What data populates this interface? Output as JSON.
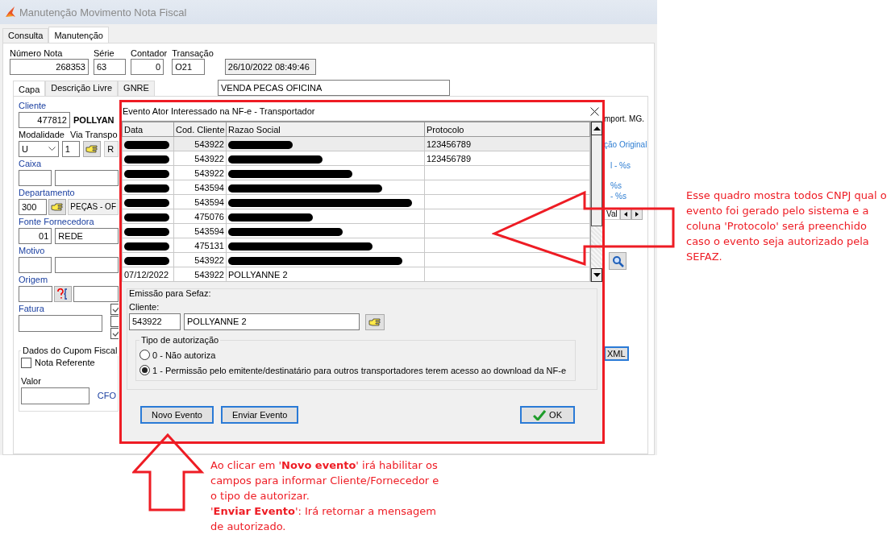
{
  "window": {
    "title": "Manutenção Movimento Nota Fiscal"
  },
  "tabs": [
    {
      "label": "Consulta",
      "selected": false
    },
    {
      "label": "Manutenção",
      "selected": true
    }
  ],
  "header_fields": [
    {
      "label": "Número Nota",
      "value": "268353",
      "kind": "numeric"
    },
    {
      "label": "Série",
      "value": "63",
      "kind": "text"
    },
    {
      "label": "Contador",
      "value": "0",
      "kind": "numeric"
    },
    {
      "label": "Transação",
      "value": "O21",
      "kind": "text"
    },
    {
      "value": "26/10/2022 08:49:46",
      "kind": "readonly"
    }
  ],
  "inner_tabs": [
    {
      "label": "Capa",
      "selected": true
    },
    {
      "label": "Descrição Livre",
      "selected": false
    },
    {
      "label": "GNRE",
      "selected": false
    }
  ],
  "description": "VENDA PECAS OFICINA",
  "capa": {
    "cliente_label": "Cliente",
    "cliente_code": "477812",
    "cliente_name": "POLLYAN",
    "modalidade_label": "Modalidade",
    "modalidade_value": "U",
    "via_label": "Via Transpo",
    "via_value": "1",
    "via_name": "R",
    "caixa_label": "Caixa",
    "departamento_label": "Departamento",
    "departamento_code": "300",
    "departamento_name": "PEÇAS - OF",
    "fonte_label": "Fonte Fornecedora",
    "fonte_code": "01",
    "fonte_name": "REDE",
    "motivo_label": "Motivo",
    "origem_label": "Origem",
    "fatura_label": "Fatura",
    "checkboxes": [
      {
        "checked": true
      },
      {
        "checked": false
      },
      {
        "checked": true
      }
    ],
    "cupom_title": "Dados do Cupom Fiscal",
    "nota_referente": {
      "label": "Nota Referente",
      "checked": false
    },
    "valor_label": "Valor",
    "cfo_label": "CFO"
  },
  "right_panel": {
    "import_text": "mport. MG.",
    "original_link": "ção Original",
    "percent_1": "l - %s",
    "percent_2": "%s",
    "percent_3": "- %s",
    "tab": "Val",
    "xml_button": "XML"
  },
  "dialog": {
    "title": "Evento Ator Interessado na NF-e - Transportador",
    "columns": [
      "Data",
      "Cod. Cliente",
      "Razao Social",
      "Protocolo"
    ],
    "rows": [
      {
        "data": null,
        "cod_cliente": "543922",
        "razao_social": null,
        "protocolo": "123456789",
        "selected": true
      },
      {
        "data": null,
        "cod_cliente": "543922",
        "razao_social": null,
        "protocolo": "123456789",
        "selected": false
      },
      {
        "data": null,
        "cod_cliente": "543922",
        "razao_social": null,
        "selected": false
      },
      {
        "data": null,
        "cod_cliente": "543594",
        "razao_social": null,
        "selected": false
      },
      {
        "data": null,
        "cod_cliente": "543594",
        "razao_social": null,
        "selected": false
      },
      {
        "data": null,
        "cod_cliente": "475076",
        "razao_social": null,
        "selected": false
      },
      {
        "data": null,
        "cod_cliente": "543594",
        "razao_social": null,
        "selected": false
      },
      {
        "data": null,
        "cod_cliente": "475131",
        "razao_social": null,
        "selected": false
      },
      {
        "data": null,
        "cod_cliente": "543922",
        "razao_social": null,
        "selected": false
      },
      {
        "data": "07/12/2022",
        "cod_cliente": "543922",
        "razao_social": "POLLYANNE 2",
        "selected": false
      }
    ],
    "emissao_title": "Emissão para Sefaz:",
    "cliente_label": "Cliente:",
    "cliente_code": "543922",
    "cliente_name": "POLLYANNE 2",
    "tipo_title": "Tipo de autorização",
    "tipo_options": [
      {
        "label": "0 - Não autoriza",
        "selected": false
      },
      {
        "label": "1 - Permissão pelo emitente/destinatário para outros transportadores terem acesso ao download da NF-e",
        "selected": true
      }
    ],
    "buttons": [
      {
        "label": "Novo Evento",
        "kind": "plain"
      },
      {
        "label": "Enviar Evento",
        "kind": "plain"
      },
      {
        "label": "OK",
        "kind": "ok"
      }
    ]
  },
  "notes": [
    {
      "text": "Esse quadro mostra todos CNPJ qual o evento foi gerado pelo sistema e a coluna 'Protocolo' será preenchido caso o evento seja autorizado pela SEFAZ.",
      "kind": "right"
    },
    {
      "text": "Ao clicar em '**Novo evento**' irá habilitar os campos para informar Cliente/Fornecedor e o tipo de autorizar.",
      "kind": "bottom"
    },
    {
      "text": "'**Enviar Evento**': Irá retornar a mensagem de autorizado.",
      "kind": "bottom2"
    }
  ]
}
